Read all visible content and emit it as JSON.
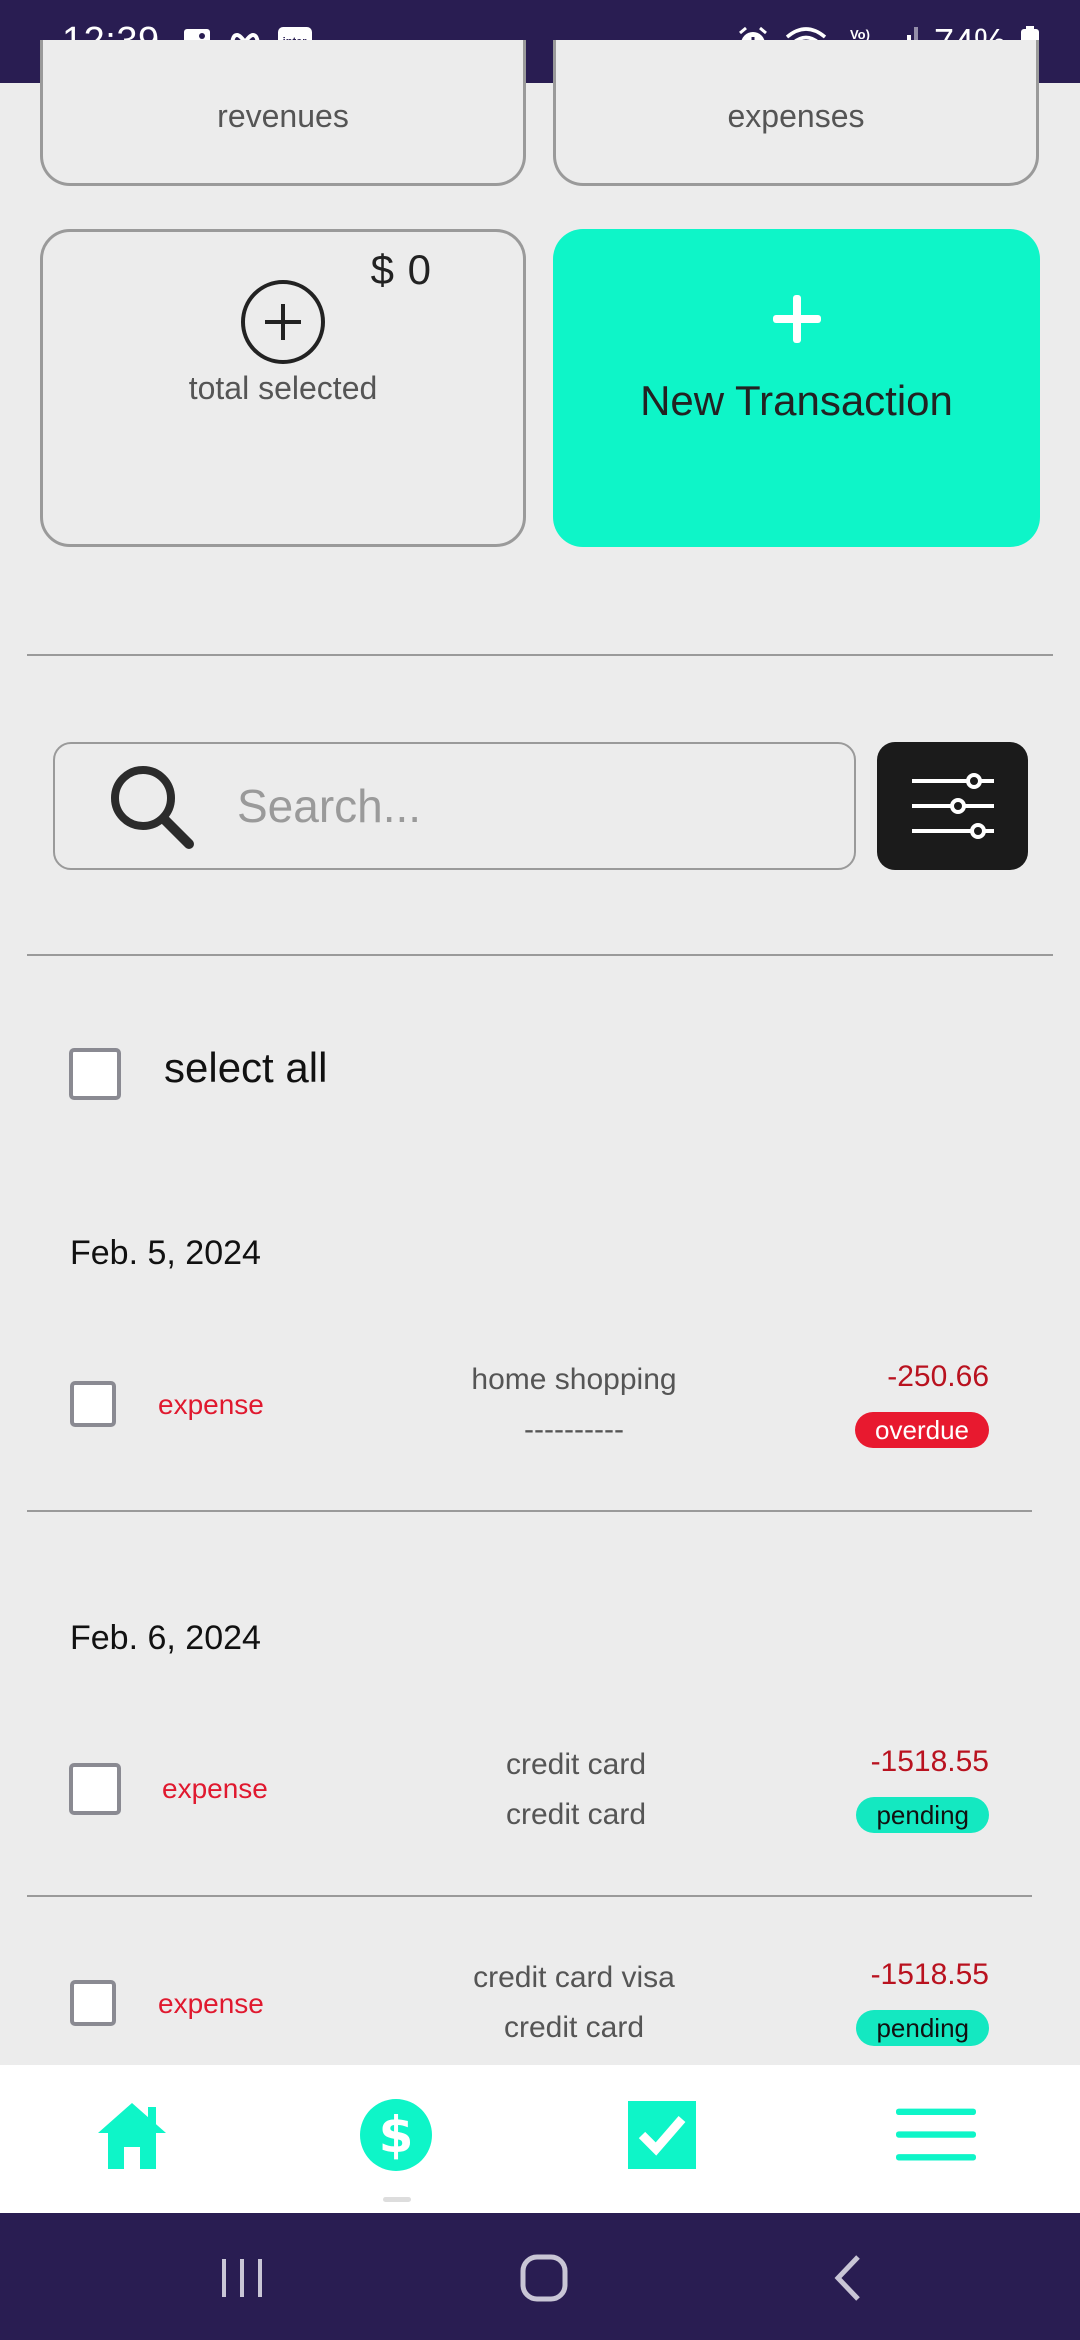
{
  "status_bar": {
    "time": "12:39",
    "inter_label": "inter",
    "lte_label": "Vo) LTE1",
    "battery": "74%",
    "icons": [
      "image-icon",
      "infinity-icon",
      "inter-app-icon",
      "alarm-icon",
      "wifi-icon",
      "signal-icon",
      "battery-icon"
    ]
  },
  "summary": {
    "revenues_label": "revenues",
    "expenses_label": "expenses",
    "total_amount": "$ 0",
    "total_label": "total selected",
    "new_transaction_label": "New Transaction"
  },
  "search": {
    "placeholder": "Search..."
  },
  "select_all_label": "select all",
  "transactions": [
    {
      "date": "Feb. 5, 2024",
      "type": "expense",
      "description": "home shopping",
      "subtitle": "----------",
      "amount": "-250.66",
      "status": "overdue"
    },
    {
      "date": "Feb. 6, 2024",
      "type": "expense",
      "description": "credit card",
      "subtitle": "credit card",
      "amount": "-1518.55",
      "status": "pending"
    },
    {
      "type": "expense",
      "description": "credit card visa",
      "subtitle": "credit card",
      "amount": "-1518.55",
      "status": "pending"
    }
  ],
  "colors": {
    "accent": "#0ef5c8",
    "status_bar": "#291d52",
    "expense_red": "#e0192f",
    "overdue": "#e8192f",
    "pending": "#14e8c1"
  },
  "bottom_nav": [
    "home-icon",
    "dollar-icon",
    "checkbox-icon",
    "menu-icon"
  ]
}
